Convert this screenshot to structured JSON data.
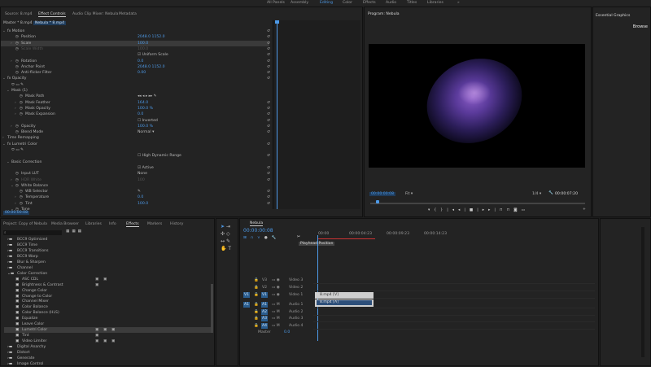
{
  "workspaces": [
    {
      "label": "All Panels"
    },
    {
      "label": "Assembly"
    },
    {
      "label": "Editing",
      "active": true
    },
    {
      "label": "Color"
    },
    {
      "label": "Effects"
    },
    {
      "label": "Audio"
    },
    {
      "label": "Titles"
    },
    {
      "label": "Libraries"
    },
    {
      "label": "»"
    }
  ],
  "effect_controls": {
    "tabs": [
      "Source: 8.mp4",
      "Effect Controls",
      "Audio Clip Mixer: Nebula",
      "Metadata"
    ],
    "master_clip": "Master * 8.mp4",
    "sequence_clip": "Nebula * 8.mp4",
    "ruler_time": "00:00:15",
    "rows": [
      {
        "label": "fx  Motion",
        "indent": 1,
        "twirl": "open",
        "reset": true
      },
      {
        "label": "Position",
        "indent": 3,
        "value": "2048.0    1152.0",
        "reset": true
      },
      {
        "label": "Scale",
        "indent": 3,
        "value": "100.0",
        "reset": true,
        "highlight": true,
        "twirl": "closed"
      },
      {
        "label": "Scale Width",
        "indent": 3,
        "value": "100.0",
        "dim": true,
        "reset": true
      },
      {
        "label": "",
        "indent": 3,
        "value": "☑ Uniform Scale",
        "plain": true,
        "reset": true
      },
      {
        "label": "Rotation",
        "indent": 3,
        "value": "0.0",
        "reset": true,
        "twirl": "closed"
      },
      {
        "label": "Anchor Point",
        "indent": 3,
        "value": "2048.0    1152.0",
        "reset": true
      },
      {
        "label": "Anti-flicker Filter",
        "indent": 3,
        "value": "0.00",
        "reset": true
      },
      {
        "label": "fx  Opacity",
        "indent": 1,
        "twirl": "open",
        "reset": true
      },
      {
        "label": "⬭ ▭ ✎",
        "indent": 2
      },
      {
        "label": "Mask (1)",
        "indent": 2,
        "twirl": "open"
      },
      {
        "label": "Mask Path",
        "indent": 4,
        "value": "◂◂ ◂ ▸ ▸▸ ✎",
        "plain": true
      },
      {
        "label": "Mask Feather",
        "indent": 4,
        "value": "164.0",
        "reset": true,
        "twirl": "closed"
      },
      {
        "label": "Mask Opacity",
        "indent": 4,
        "value": "100.0 %",
        "reset": true,
        "twirl": "closed"
      },
      {
        "label": "Mask Expansion",
        "indent": 4,
        "value": "0.0",
        "reset": true,
        "twirl": "closed"
      },
      {
        "label": "",
        "indent": 4,
        "value": "☐ Inverted",
        "plain": true,
        "reset": true
      },
      {
        "label": "Opacity",
        "indent": 3,
        "value": "100.0 %",
        "reset": true,
        "twirl": "closed"
      },
      {
        "label": "Blend Mode",
        "indent": 3,
        "value": "Normal ▾",
        "plain": true,
        "reset": true
      },
      {
        "label": "Time Remapping",
        "indent": 1,
        "twirl": "closed"
      },
      {
        "label": "fx  Lumetri Color",
        "indent": 1,
        "twirl": "open",
        "reset": true
      },
      {
        "label": "⬭ ▭ ✎",
        "indent": 2
      },
      {
        "label": "",
        "indent": 2,
        "value": "☐ High Dynamic Range",
        "plain": true,
        "reset": true
      },
      {
        "label": "Basic Correction",
        "indent": 2,
        "twirl": "open"
      },
      {
        "label": "",
        "indent": 2,
        "value": "☑ Active",
        "plain": true,
        "reset": true
      },
      {
        "label": "Input LUT",
        "indent": 3,
        "value": "None",
        "plain": true,
        "reset": true
      },
      {
        "label": "HDR White",
        "indent": 3,
        "value": "100",
        "dim": true,
        "reset": true,
        "twirl": "closed"
      },
      {
        "label": "White Balance",
        "indent": 3,
        "twirl": "open"
      },
      {
        "label": "WB Selector",
        "indent": 4,
        "value": "✎",
        "plain": true,
        "reset": true
      },
      {
        "label": "Temperature",
        "indent": 4,
        "value": "0.0",
        "reset": true,
        "twirl": "closed"
      },
      {
        "label": "Tint",
        "indent": 4,
        "value": "100.0",
        "reset": true,
        "twirl": "closed"
      },
      {
        "label": "Tone",
        "indent": 3,
        "twirl": "open"
      }
    ],
    "timecode": "00:00:00:08"
  },
  "program": {
    "title": "Program: Nebula",
    "timecode": "00:00:00:08",
    "fit": "Fit",
    "resolution": "1/4",
    "duration": "00:00:07:20"
  },
  "essential_graphics": {
    "title": "Essential Graphics",
    "tab": "Browse"
  },
  "effects_panel": {
    "tabs": [
      "Project: Copy of Nebula",
      "Media Browser",
      "Libraries",
      "Info",
      "Effects",
      "Markers",
      "History"
    ],
    "items": [
      {
        "label": "BCC9 Optimized",
        "type": "folder"
      },
      {
        "label": "BCC9 Time",
        "type": "folder"
      },
      {
        "label": "BCC9 Transitions",
        "type": "folder"
      },
      {
        "label": "BCC9 Warp",
        "type": "folder"
      },
      {
        "label": "Blur & Sharpen",
        "type": "folder"
      },
      {
        "label": "Channel",
        "type": "folder"
      },
      {
        "label": "Color Correction",
        "type": "folder",
        "open": true
      },
      {
        "label": "ASC CDL",
        "type": "effect",
        "badges": 2
      },
      {
        "label": "Brightness & Contrast",
        "type": "effect",
        "badges": 1
      },
      {
        "label": "Change Color",
        "type": "effect"
      },
      {
        "label": "Change to Color",
        "type": "effect"
      },
      {
        "label": "Channel Mixer",
        "type": "effect"
      },
      {
        "label": "Color Balance",
        "type": "effect"
      },
      {
        "label": "Color Balance (HLS)",
        "type": "effect"
      },
      {
        "label": "Equalize",
        "type": "effect"
      },
      {
        "label": "Leave Color",
        "type": "effect"
      },
      {
        "label": "Lumetri Color",
        "type": "effect",
        "badges": 3,
        "highlight": true
      },
      {
        "label": "Tint",
        "type": "effect",
        "badges": 1
      },
      {
        "label": "Video Limiter",
        "type": "effect",
        "badges": 3
      },
      {
        "label": "Digital Anarchy",
        "type": "folder"
      },
      {
        "label": "Distort",
        "type": "folder"
      },
      {
        "label": "Generate",
        "type": "folder"
      },
      {
        "label": "Image Control",
        "type": "folder"
      }
    ]
  },
  "timeline": {
    "tab": "Nebula",
    "timecode": "00:00:00:08",
    "ruler": [
      "00:00",
      "00:00:04:23",
      "00:00:09:23",
      "00:00:14:23"
    ],
    "tooltip": "Playhead Position",
    "tracks": [
      {
        "src": "",
        "name": "V3",
        "label": "Video 3"
      },
      {
        "src": "",
        "name": "V2",
        "label": "Video 2"
      },
      {
        "src": "V1",
        "name": "V1",
        "label": "Video 1"
      },
      {
        "src": "A1",
        "name": "A1",
        "label": "Audio 1"
      },
      {
        "src": "",
        "name": "A2",
        "label": "Audio 2"
      },
      {
        "src": "",
        "name": "A3",
        "label": "Audio 3"
      },
      {
        "src": "",
        "name": "A4",
        "label": "Audio 4"
      }
    ],
    "master": {
      "label": "Master",
      "value": "0.0"
    },
    "clips": [
      {
        "label": "8.mp4 [V]"
      },
      {
        "label": "8.mp4 [A]"
      }
    ]
  },
  "colors": {
    "accent": "#4d9ae8",
    "background": "#1d1d1d",
    "panel": "#232323"
  }
}
